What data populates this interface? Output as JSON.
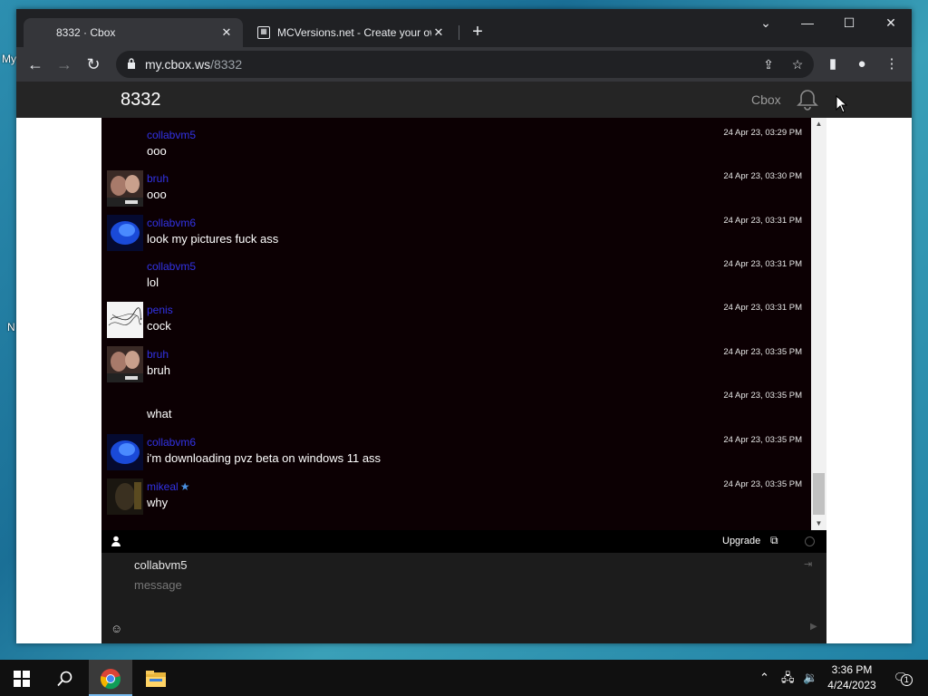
{
  "desktop": {
    "icon_label_1": "My",
    "icon_label_2": "N"
  },
  "browser": {
    "tabs": [
      {
        "title": "8332 · Cbox",
        "active": true
      },
      {
        "title": "MCVersions.net - Create your ow",
        "active": false
      }
    ],
    "url_host": "my.cbox.ws",
    "url_path": "/8332"
  },
  "cbox": {
    "title": "8332",
    "brand": "Cbox",
    "messages": [
      {
        "user": "collabvm5",
        "text": "ooo",
        "time": "24 Apr 23, 03:29 PM",
        "avatar": "none"
      },
      {
        "user": "bruh",
        "text": "ooo",
        "time": "24 Apr 23, 03:30 PM",
        "avatar": "bruh"
      },
      {
        "user": "collabvm6",
        "text": "look my pictures fuck ass",
        "time": "24 Apr 23, 03:31 PM",
        "avatar": "blue"
      },
      {
        "user": "collabvm5",
        "text": "lol",
        "time": "24 Apr 23, 03:31 PM",
        "avatar": "none"
      },
      {
        "user": "penis",
        "text": "cock",
        "time": "24 Apr 23, 03:31 PM",
        "avatar": "scribble"
      },
      {
        "user": "bruh",
        "text": "bruh",
        "time": "24 Apr 23, 03:35 PM",
        "avatar": "bruh"
      },
      {
        "user": "",
        "text": "what",
        "time": "24 Apr 23, 03:35 PM",
        "avatar": "none"
      },
      {
        "user": "collabvm6",
        "text": "i'm downloading pvz beta on windows 11 ass",
        "time": "24 Apr 23, 03:35 PM",
        "avatar": "blue"
      },
      {
        "user": "mikeal",
        "text": "why",
        "time": "24 Apr 23, 03:35 PM",
        "avatar": "dark",
        "star": true
      }
    ],
    "status": {
      "upgrade_label": "Upgrade"
    },
    "composer": {
      "username": "collabvm5",
      "placeholder": "message"
    }
  },
  "taskbar": {
    "time": "3:36 PM",
    "date": "4/24/2023",
    "notifications": "1"
  },
  "colors": {
    "username": "#3232e6",
    "chat_bg": "#0c0003",
    "header_bg": "#252525"
  }
}
